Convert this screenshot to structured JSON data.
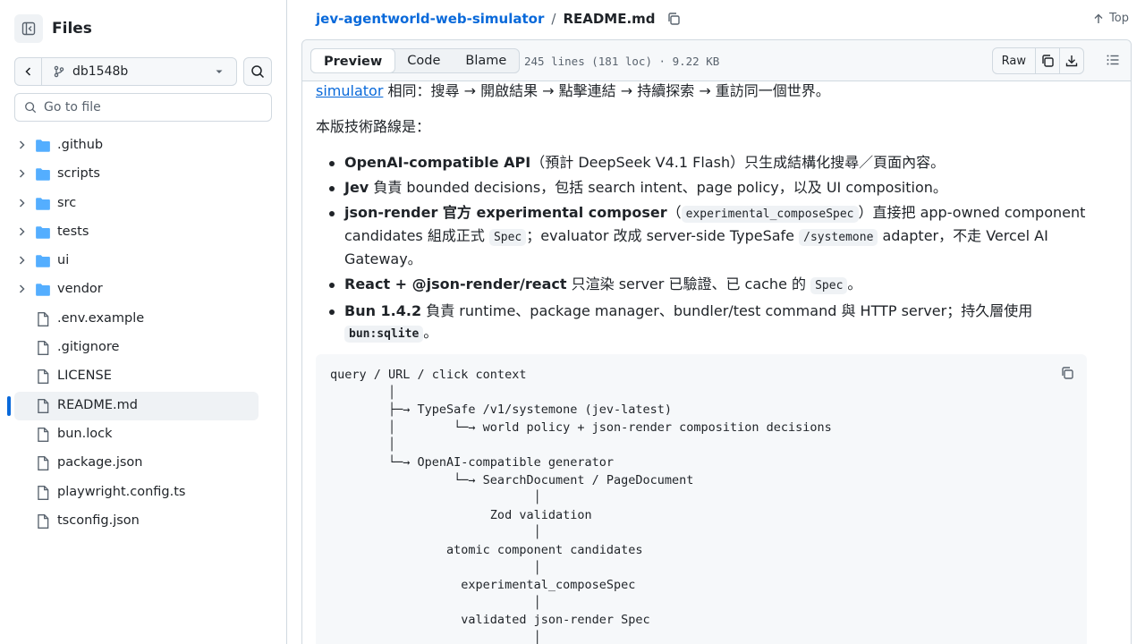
{
  "sidebar": {
    "title": "Files",
    "branch": "db1548b",
    "goto_placeholder": "Go to file",
    "items": [
      {
        "label": ".github",
        "type": "folder"
      },
      {
        "label": "scripts",
        "type": "folder"
      },
      {
        "label": "src",
        "type": "folder"
      },
      {
        "label": "tests",
        "type": "folder"
      },
      {
        "label": "ui",
        "type": "folder"
      },
      {
        "label": "vendor",
        "type": "folder"
      },
      {
        "label": ".env.example",
        "type": "file"
      },
      {
        "label": ".gitignore",
        "type": "file"
      },
      {
        "label": "LICENSE",
        "type": "file"
      },
      {
        "label": "README.md",
        "type": "file",
        "active": true
      },
      {
        "label": "bun.lock",
        "type": "file"
      },
      {
        "label": "package.json",
        "type": "file"
      },
      {
        "label": "playwright.config.ts",
        "type": "file"
      },
      {
        "label": "tsconfig.json",
        "type": "file"
      }
    ]
  },
  "header": {
    "repo": "jev-agentworld-web-simulator",
    "separator": "/",
    "file": "README.md",
    "top_label": "Top"
  },
  "file_header": {
    "tabs": [
      "Preview",
      "Code",
      "Blame"
    ],
    "active_tab": "Preview",
    "meta": "245 lines (181 loc) · 9.22 KB",
    "raw_label": "Raw"
  },
  "readme": {
    "p1_link": "simulator",
    "p1_text": " 相同：搜尋 → 開啟結果 → 點擊連結 → 持續探索 → 重訪同一個世界。",
    "p2": "本版技術路線是：",
    "b1_bold": "OpenAI-compatible API",
    "b1_text": "（預計 DeepSeek V4.1 Flash）只生成結構化搜尋／頁面內容。",
    "b2_bold": "Jev",
    "b2_text": " 負責 bounded decisions，包括 search intent、page policy，以及 UI composition。",
    "b3_bold": "json-render 官方 experimental composer",
    "b3_t1": "（",
    "b3_code1": "experimental_composeSpec",
    "b3_t2": "）直接把 app-owned component candidates 組成正式 ",
    "b3_code2": "Spec",
    "b3_t3": "；evaluator 改成 server-side TypeSafe ",
    "b3_code3": "/systemone",
    "b3_t4": " adapter，不走 Vercel AI Gateway。",
    "b4_bold": "React + @json-render/react",
    "b4_t1": " 只渲染 server 已驗證、已 cache 的 ",
    "b4_code": "Spec",
    "b4_t2": "。",
    "b5_bold": "Bun 1.4.2",
    "b5_t1": " 負責 runtime、package manager、bundler/test command 與 HTTP server；持久層使用 ",
    "b5_code": "bun:sqlite",
    "b5_t2": "。",
    "code_block": "query / URL / click context\n        │\n        ├─→ TypeSafe /v1/systemone (jev-latest)\n        │        └─→ world policy + json-render composition decisions\n        │\n        └─→ OpenAI-compatible generator\n                 └─→ SearchDocument / PageDocument\n                            │\n                      Zod validation\n                            │\n                atomic component candidates\n                            │\n                  experimental_composeSpec\n                            │\n                  validated json-render Spec\n                            │"
  },
  "colors": {
    "accent": "#0969da",
    "folder": "#54aeff",
    "border": "#d1d9e0",
    "muted": "#59636e"
  }
}
